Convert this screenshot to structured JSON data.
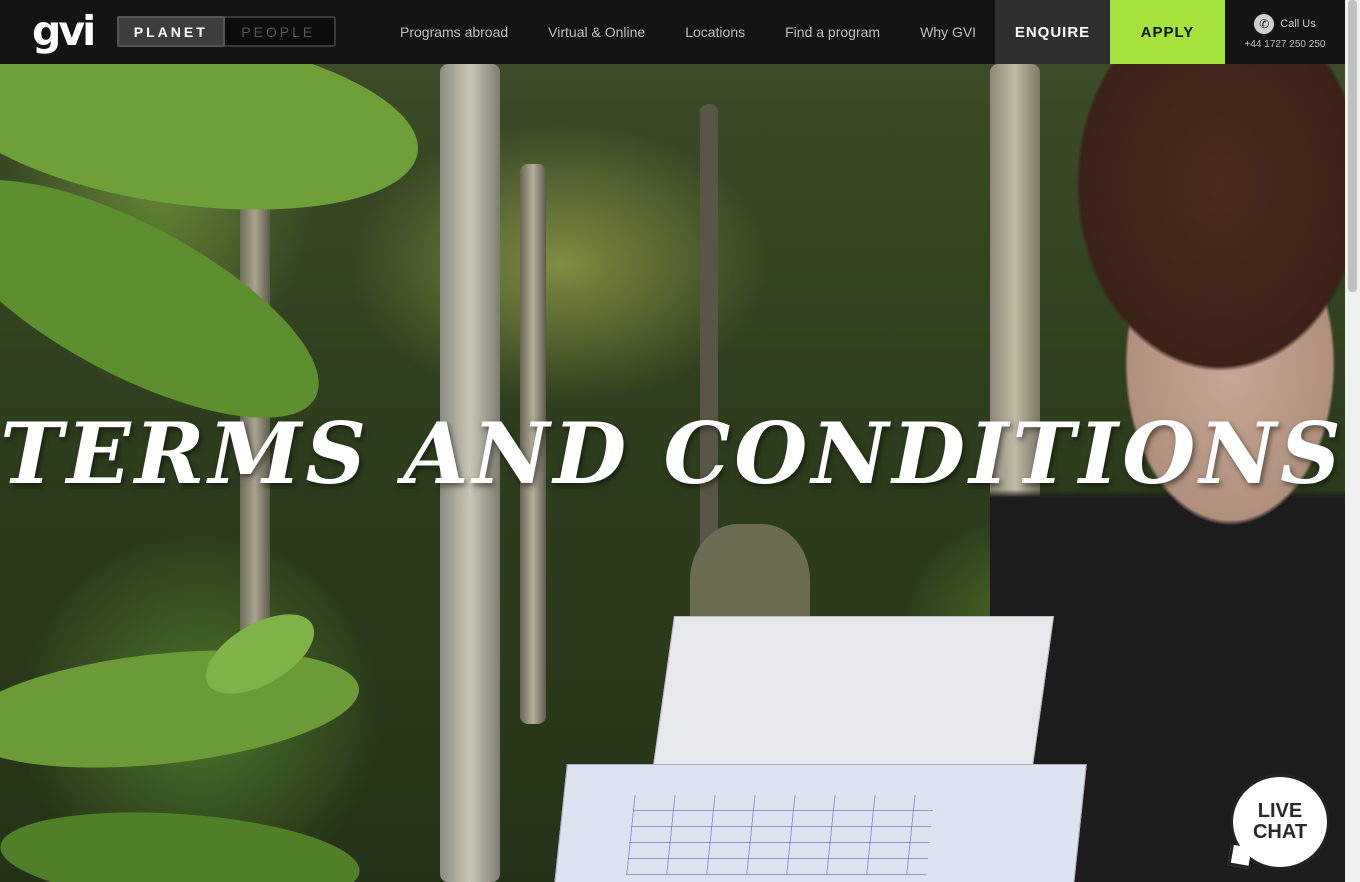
{
  "header": {
    "logo": "gvi",
    "toggle": {
      "active": "PLANET",
      "inactive": "PEOPLE"
    },
    "nav": [
      {
        "label": "Programs abroad"
      },
      {
        "label": "Virtual & Online"
      },
      {
        "label": "Locations"
      },
      {
        "label": "Find a program"
      },
      {
        "label": "Why GVI"
      }
    ],
    "enquire_label": "ENQUIRE",
    "apply_label": "APPLY",
    "call": {
      "label": "Call Us",
      "number": "+44 1727 250 250",
      "icon": "phone-icon"
    }
  },
  "hero": {
    "title": "Terms and Conditions"
  },
  "live_chat": {
    "line1": "LIVE",
    "line2": "CHAT"
  },
  "colors": {
    "accent": "#a6e23c",
    "header_bg": "#141414",
    "enquire_bg": "#2f2f2f"
  }
}
